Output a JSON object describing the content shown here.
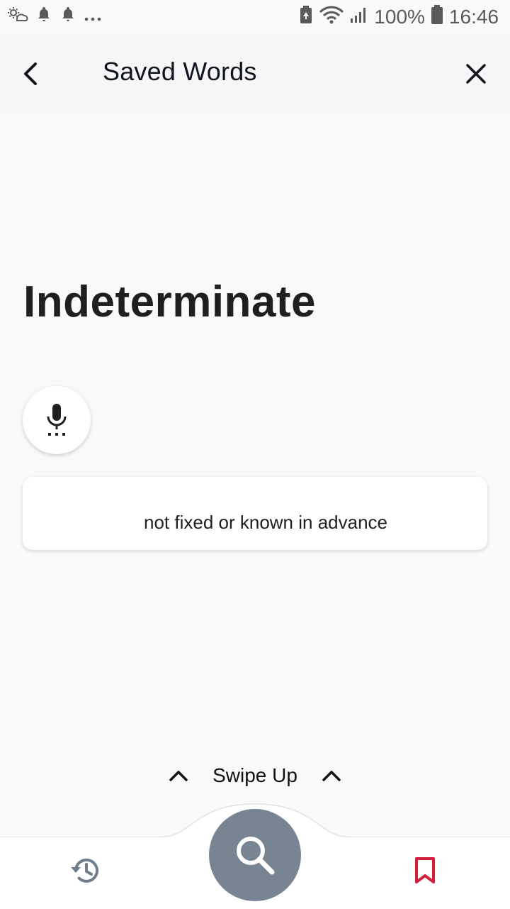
{
  "status_bar": {
    "battery": "100%",
    "time": "16:46",
    "left_icons": [
      "weather-icon",
      "bell-icon",
      "bell-icon",
      "more-notifications-icon"
    ],
    "right_icons": [
      "battery-saver-icon",
      "wifi-icon",
      "signal-icon",
      "battery-icon"
    ]
  },
  "header": {
    "title": "Saved Words",
    "back_icon": "chevron-left-icon",
    "close_icon": "close-icon"
  },
  "word_card": {
    "word": "Indeterminate",
    "definition": "not fixed or known in advance",
    "mic_icon": "microphone-icon"
  },
  "swipe_hint": {
    "label": "Swipe Up"
  },
  "bottom_nav": {
    "history_icon": "history-icon",
    "search_icon": "search-icon",
    "bookmark_icon": "bookmark-icon",
    "colors": {
      "fab": "#778593",
      "history": "#6f7d8c",
      "bookmark": "#d0203a"
    }
  }
}
